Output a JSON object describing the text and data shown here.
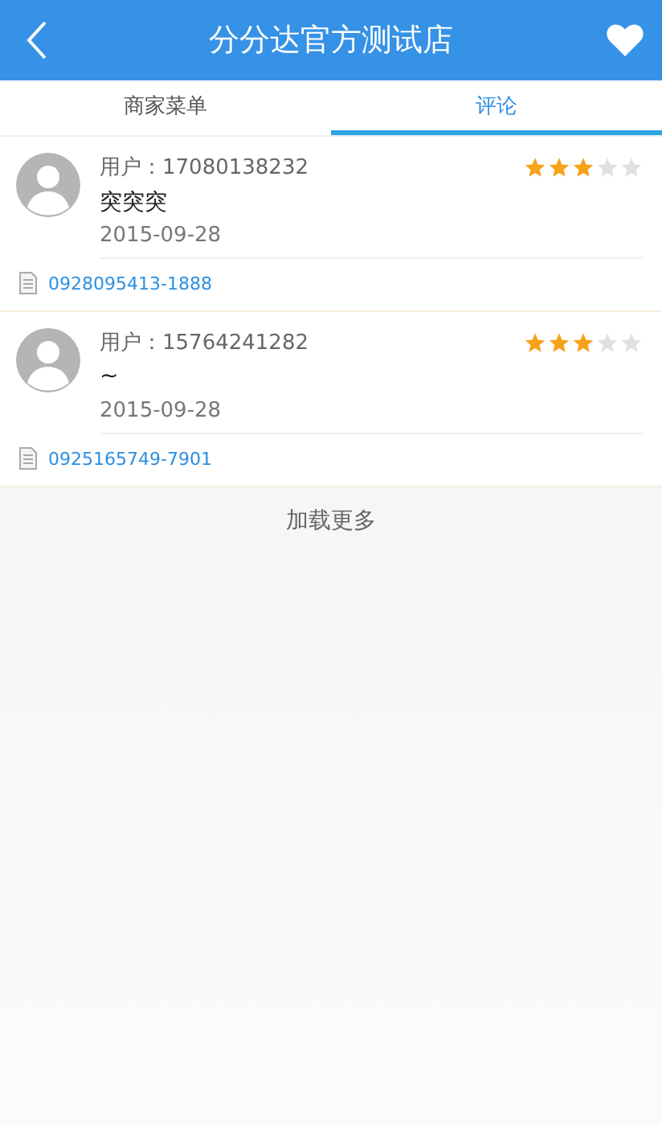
{
  "header": {
    "title": "分分达官方测试店"
  },
  "tabs": [
    {
      "label": "商家菜单",
      "selected": false
    },
    {
      "label": "评论",
      "selected": true
    }
  ],
  "reviews": [
    {
      "user": "用户：17080138232",
      "stars": 3,
      "comment": "突突突",
      "date": "2015-09-28",
      "order": "0928095413-1888"
    },
    {
      "user": "用户：15764241282",
      "stars": 3,
      "comment": "~",
      "date": "2015-09-28",
      "order": "0925165749-7901"
    }
  ],
  "load_more": "加载更多"
}
